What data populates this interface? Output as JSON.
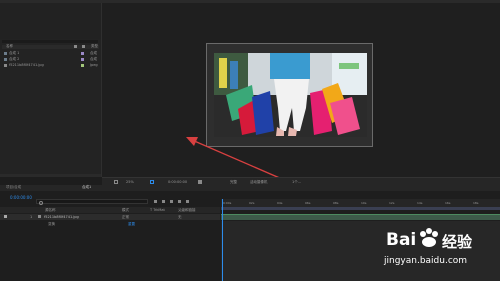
{
  "project": {
    "columns": {
      "name": "名称",
      "type": "类型"
    },
    "items": [
      {
        "name": "合成 1",
        "type": "合成"
      },
      {
        "name": "合成 2",
        "type": "合成"
      },
      {
        "name": "f5211b8f0f4741.jpg",
        "type": "Jpeg"
      }
    ]
  },
  "viewer": {
    "zoom": "25%",
    "timecode": "0:00:00:00",
    "quality": "完整",
    "camera": "活动摄像机",
    "views": "1个..."
  },
  "timeline": {
    "panel_title": "项目/合成",
    "tab_label": "合成1",
    "current_time": "0:00:00:00",
    "search_placeholder": "",
    "columns": {
      "source": "源名称",
      "mode": "模式",
      "trkmat": "T TrkMat",
      "parent": "父级和链接"
    },
    "layers": [
      {
        "index": "1",
        "name": "f5211b8f0f4741.jpg",
        "mode": "正常",
        "parent": "无"
      }
    ],
    "sub_label": "变换",
    "sub_value": "重置",
    "ruler": [
      "0:00s",
      "02s",
      "04s",
      "06s",
      "08s",
      "10s",
      "12s",
      "14s",
      "16s",
      "18s"
    ]
  },
  "watermark": {
    "brand": "Bai",
    "brand2": "经验",
    "url": "jingyan.baidu.com"
  },
  "colors": {
    "accent": "#2d8ceb",
    "arrow": "#d84040",
    "panel": "#232323"
  }
}
